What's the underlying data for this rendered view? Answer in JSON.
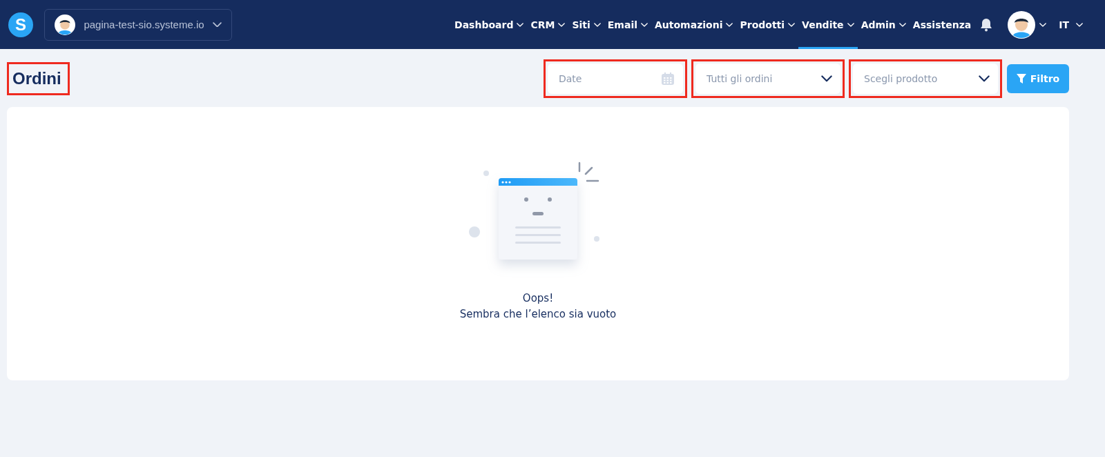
{
  "header": {
    "logo": "S",
    "site_selector": {
      "label": "pagina-test-sio.systeme.io"
    },
    "nav": [
      {
        "label": "Dashboard",
        "dropdown": true,
        "selected": false
      },
      {
        "label": "CRM",
        "dropdown": true,
        "selected": false
      },
      {
        "label": "Siti",
        "dropdown": true,
        "selected": false
      },
      {
        "label": "Email",
        "dropdown": true,
        "selected": false
      },
      {
        "label": "Automazioni",
        "dropdown": true,
        "selected": false
      },
      {
        "label": "Prodotti",
        "dropdown": true,
        "selected": false
      },
      {
        "label": "Vendite",
        "dropdown": true,
        "selected": true
      },
      {
        "label": "Admin",
        "dropdown": true,
        "selected": false
      },
      {
        "label": "Assistenza",
        "dropdown": false,
        "selected": false
      }
    ],
    "language": "IT"
  },
  "page": {
    "title": "Ordini",
    "title_highlighted": true,
    "filters": [
      {
        "kind": "date",
        "placeholder": "Date",
        "highlighted": true
      },
      {
        "kind": "select",
        "placeholder": "Tutti gli ordini",
        "highlighted": true
      },
      {
        "kind": "select",
        "placeholder": "Scegli prodotto",
        "highlighted": true
      }
    ],
    "filter_button": "Filtro"
  },
  "empty_state": {
    "title": "Oops!",
    "message": "Sembra che l’elenco sia vuoto"
  }
}
